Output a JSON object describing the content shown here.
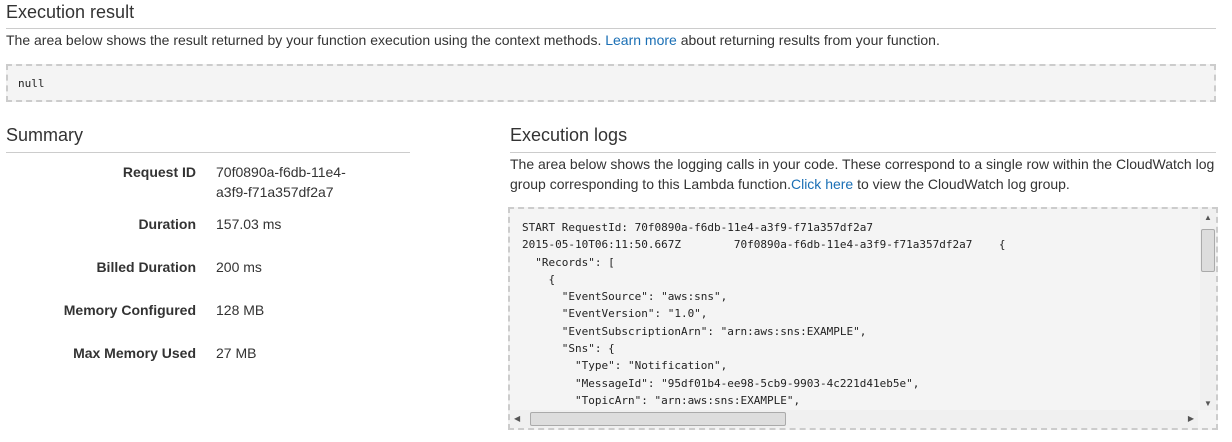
{
  "result": {
    "title": "Execution result",
    "desc_pre": "The area below shows the result returned by your function execution using the context methods. ",
    "link": "Learn more",
    "desc_post": " about returning results from your function.",
    "value": "null"
  },
  "summary": {
    "title": "Summary",
    "rows": [
      {
        "label": "Request ID",
        "value": "70f0890a-f6db-11e4-a3f9-f71a357df2a7"
      },
      {
        "label": "Duration",
        "value": "157.03 ms"
      },
      {
        "label": "Billed Duration",
        "value": "200 ms"
      },
      {
        "label": "Memory Configured",
        "value": "128 MB"
      },
      {
        "label": "Max Memory Used",
        "value": "27 MB"
      }
    ]
  },
  "logs": {
    "title": "Execution logs",
    "desc_pre": "The area below shows the logging calls in your code. These correspond to a single row within the CloudWatch log group corresponding to this Lambda function.",
    "link": "Click here",
    "desc_post": " to view the CloudWatch log group.",
    "lines": [
      "START RequestId: 70f0890a-f6db-11e4-a3f9-f71a357df2a7",
      "2015-05-10T06:11:50.667Z        70f0890a-f6db-11e4-a3f9-f71a357df2a7    {",
      "  \"Records\": [",
      "    {",
      "      \"EventSource\": \"aws:sns\",",
      "      \"EventVersion\": \"1.0\",",
      "      \"EventSubscriptionArn\": \"arn:aws:sns:EXAMPLE\",",
      "      \"Sns\": {",
      "        \"Type\": \"Notification\",",
      "        \"MessageId\": \"95df01b4-ee98-5cb9-9903-4c221d41eb5e\",",
      "        \"TopicArn\": \"arn:aws:sns:EXAMPLE\","
    ]
  }
}
